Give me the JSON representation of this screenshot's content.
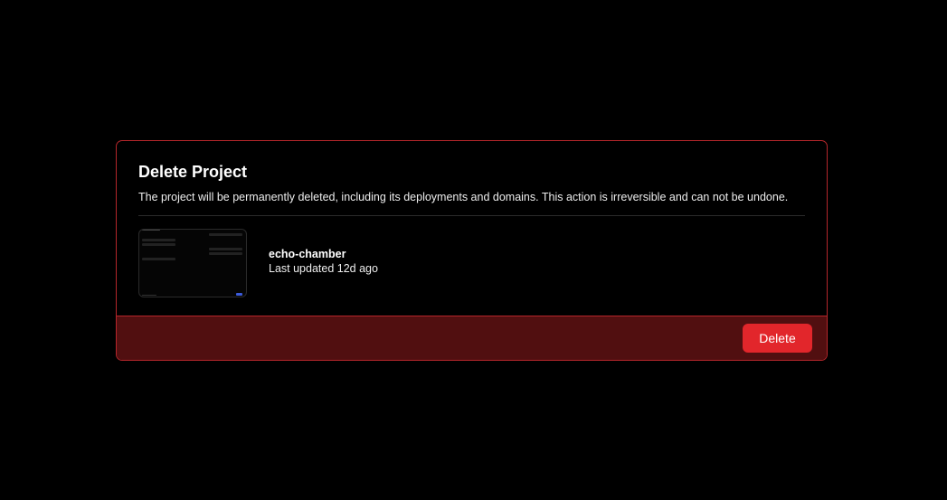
{
  "dialog": {
    "title": "Delete Project",
    "description": "The project will be permanently deleted, including its deployments and domains. This action is irreversible and can not be undone."
  },
  "project": {
    "name": "echo-chamber",
    "last_updated": "Last updated 12d ago"
  },
  "footer": {
    "delete_label": "Delete"
  },
  "colors": {
    "background": "#000000",
    "border_danger": "#b5262b",
    "footer_background": "#510f10",
    "button_danger": "#e2262b",
    "text_primary": "#ffffff"
  }
}
